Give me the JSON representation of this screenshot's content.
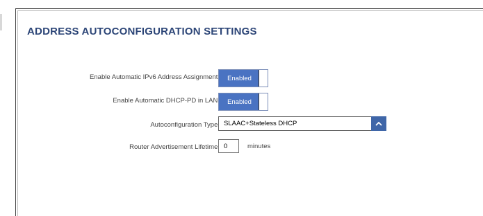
{
  "section": {
    "title": "ADDRESS AUTOCONFIGURATION SETTINGS"
  },
  "fields": {
    "ipv6_assignment": {
      "label": "Enable Automatic IPv6 Address Assignment:",
      "value": "Enabled"
    },
    "dhcp_pd": {
      "label": "Enable Automatic DHCP-PD in LAN:",
      "value": "Enabled"
    },
    "autoconfig_type": {
      "label": "Autoconfiguration Type:",
      "value": "SLAAC+Stateless DHCP",
      "icon": "chevron-up-icon"
    },
    "ra_lifetime": {
      "label": "Router Advertisement Lifetime:",
      "value": "0",
      "unit": "minutes"
    }
  },
  "colors": {
    "title": "#2c4577",
    "toggle_on": "#4a73c2",
    "select_button": "#3f66a8"
  }
}
